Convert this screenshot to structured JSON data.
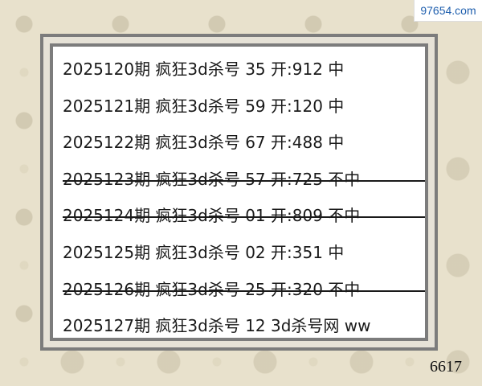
{
  "watermark": {
    "text": "97654.com"
  },
  "rows": [
    {
      "text": "2025120期 疯狂3d杀号 35  开:912 中",
      "struck": false
    },
    {
      "text": "2025121期 疯狂3d杀号 59  开:120 中",
      "struck": false
    },
    {
      "text": "2025122期 疯狂3d杀号 67  开:488 中",
      "struck": false
    },
    {
      "text": "2025123期 疯狂3d杀号 57  开:725 不中",
      "struck": true
    },
    {
      "text": "2025124期 疯狂3d杀号 01  开:809 不中",
      "struck": true
    },
    {
      "text": "2025125期 疯狂3d杀号 02  开:351 中",
      "struck": false
    },
    {
      "text": "2025126期 疯狂3d杀号 25  开:320 不中",
      "struck": true
    },
    {
      "text": "2025127期 疯狂3d杀号 12  3d杀号网 ww",
      "struck": false
    }
  ],
  "code": "6617"
}
